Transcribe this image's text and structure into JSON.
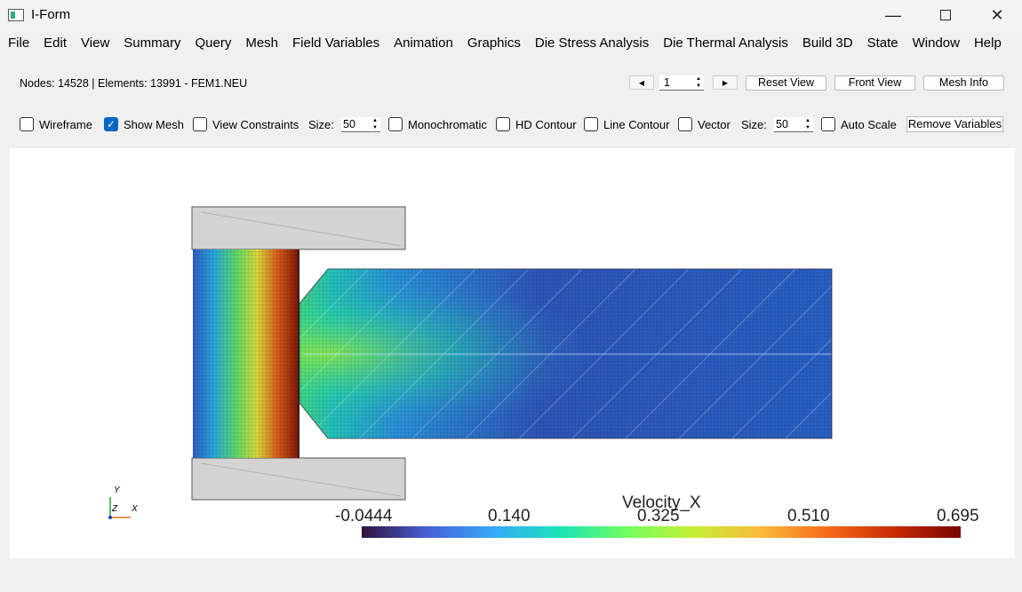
{
  "window": {
    "title": "I-Form"
  },
  "menu": [
    "File",
    "Edit",
    "View",
    "Summary",
    "Query",
    "Mesh",
    "Field Variables",
    "Animation",
    "Graphics",
    "Die Stress Analysis",
    "Die Thermal Analysis",
    "Build 3D",
    "State",
    "Window",
    "Help"
  ],
  "info": {
    "text": "Nodes: 14528 | Elements: 13991 - FEM1.NEU"
  },
  "toolbar": {
    "page_value": "1",
    "reset_view": "Reset View",
    "front_view": "Front View",
    "mesh_info": "Mesh Info"
  },
  "options": {
    "wireframe": "Wireframe",
    "show_mesh": "Show Mesh",
    "view_constraints": "View Constraints",
    "size_label_1": "Size:",
    "size_value_1": "50",
    "monochromatic": "Monochromatic",
    "hd_contour": "HD Contour",
    "line_contour": "Line Contour",
    "vector": "Vector",
    "size_label_2": "Size:",
    "size_value_2": "50",
    "auto_scale": "Auto Scale",
    "remove_variables": "Remove Variables"
  },
  "legend": {
    "title": "Velocity_X",
    "ticks": [
      "-0.0444",
      "0.140",
      "0.325",
      "0.510",
      "0.695"
    ]
  },
  "axes_triad": {
    "y": "Y",
    "z": "Z",
    "x": "X"
  }
}
